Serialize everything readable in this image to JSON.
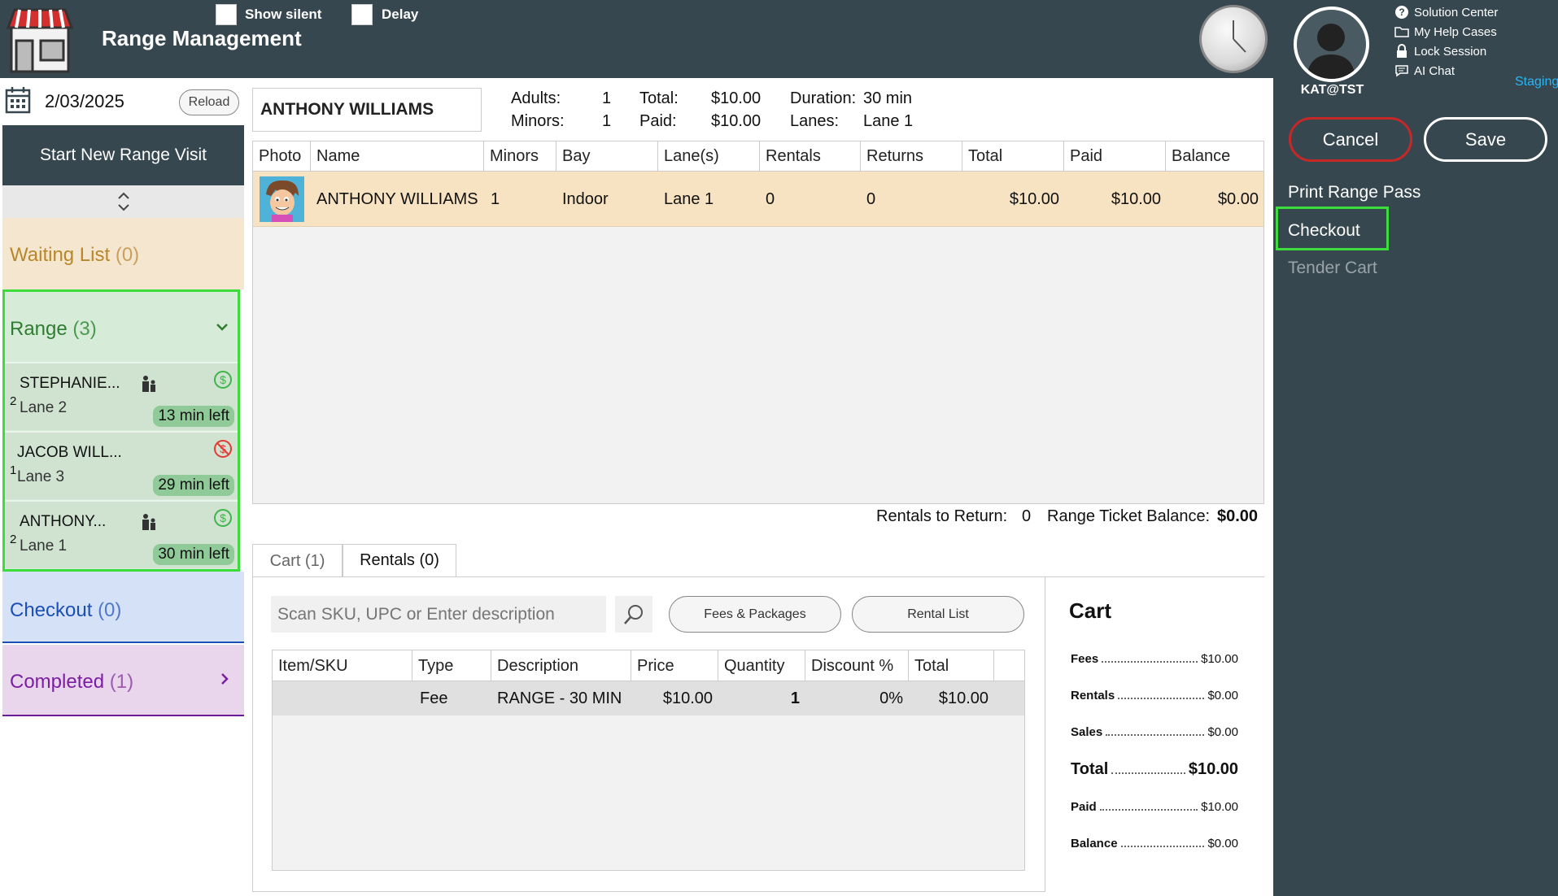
{
  "header": {
    "title": "Range Management",
    "show_silent_label": "Show silent",
    "delay_label": "Delay"
  },
  "user": {
    "label": "KAT@TST",
    "links": [
      "Solution Center",
      "My Help Cases",
      "Lock Session",
      "AI Chat"
    ],
    "environment": "Staging"
  },
  "actions": {
    "cancel": "Cancel",
    "save": "Save",
    "print_range_pass": "Print Range Pass",
    "checkout": "Checkout",
    "tender_cart": "Tender Cart"
  },
  "sidebar": {
    "date": "2/03/2025",
    "reload": "Reload",
    "start_new": "Start New Range Visit",
    "waiting": {
      "label": "Waiting List",
      "count": "(0)"
    },
    "range": {
      "label": "Range",
      "count": "(3)"
    },
    "visits": [
      {
        "count": "2",
        "name": "STEPHANIE...",
        "lane": "Lane 2",
        "time": "13 min left",
        "pay_status": "paid"
      },
      {
        "count": "1",
        "name": "JACOB WILL...",
        "lane": "Lane 3",
        "time": "29 min left",
        "pay_status": "unpaid"
      },
      {
        "count": "2",
        "name": "ANTHONY...",
        "lane": "Lane 1",
        "time": "30 min left",
        "pay_status": "paid"
      }
    ],
    "checkout": {
      "label": "Checkout",
      "count": "(0)"
    },
    "completed": {
      "label": "Completed",
      "count": "(1)"
    }
  },
  "visit": {
    "customer_name": "ANTHONY WILLIAMS",
    "adults_label": "Adults:",
    "adults": "1",
    "minors_label": "Minors:",
    "minors": "1",
    "total_label": "Total:",
    "total": "$10.00",
    "paid_label": "Paid:",
    "paid": "$10.00",
    "duration_label": "Duration:",
    "duration": "30 min",
    "lanes_label": "Lanes:",
    "lanes": "Lane 1"
  },
  "visit_table": {
    "columns": [
      "Photo",
      "Name",
      "Minors",
      "Bay",
      "Lane(s)",
      "Rentals",
      "Returns",
      "Total",
      "Paid",
      "Balance"
    ],
    "rows": [
      {
        "name": "ANTHONY WILLIAMS",
        "minors": "1",
        "bay": "Indoor",
        "lanes": "Lane 1",
        "rentals": "0",
        "returns": "0",
        "total": "$10.00",
        "paid": "$10.00",
        "balance": "$0.00"
      }
    ]
  },
  "summary": {
    "rentals_to_return_label": "Rentals to Return:",
    "rentals_to_return": "0",
    "ticket_balance_label": "Range Ticket Balance:",
    "ticket_balance": "$0.00"
  },
  "tabs": [
    "Cart (1)",
    "Rentals (0)"
  ],
  "cart": {
    "search_placeholder": "Scan SKU, UPC or Enter description",
    "fees_button": "Fees & Packages",
    "rental_list_button": "Rental List",
    "columns": [
      "Item/SKU",
      "Type",
      "Description",
      "Price",
      "Quantity",
      "Discount %",
      "Total"
    ],
    "rows": [
      {
        "sku": "",
        "type": "Fee",
        "description": "RANGE - 30 MIN",
        "price": "$10.00",
        "quantity": "1",
        "discount": "0%",
        "total": "$10.00"
      }
    ]
  },
  "cart_summary": {
    "title": "Cart",
    "fees_label": "Fees",
    "fees": "$10.00",
    "rentals_label": "Rentals",
    "rentals": "$0.00",
    "sales_label": "Sales",
    "sales": "$0.00",
    "total_label": "Total",
    "total": "$10.00",
    "paid_label": "Paid",
    "paid": "$10.00",
    "balance_label": "Balance",
    "balance": "$0.00"
  },
  "colors": {
    "dark": "#37474f",
    "highlight": "#3ddc3d",
    "cancel_border": "#c62828",
    "staging": "#29b6f6"
  }
}
